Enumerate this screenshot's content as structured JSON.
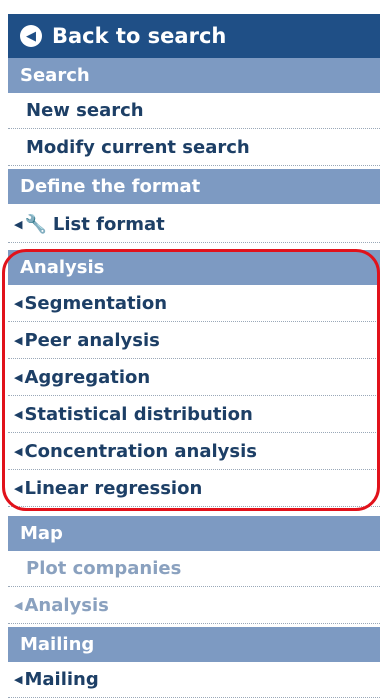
{
  "back_button": {
    "label": "Back to search",
    "icon": "back-arrow-circle-icon"
  },
  "sections": {
    "search": {
      "header": "Search",
      "items": [
        "New search",
        "Modify current search"
      ]
    },
    "format": {
      "header": "Define the format",
      "items": [
        "List format"
      ]
    },
    "analysis": {
      "header": "Analysis",
      "items": [
        "Segmentation",
        "Peer analysis",
        "Aggregation",
        "Statistical distribution",
        "Concentration analysis",
        "Linear regression"
      ]
    },
    "map": {
      "header": "Map",
      "items": [
        "Plot companies",
        "Analysis"
      ]
    },
    "mailing": {
      "header": "Mailing",
      "items": [
        "Mailing"
      ]
    }
  },
  "colors": {
    "nav_blue": "#1f4f86",
    "header_blue": "#7d9ac2",
    "link_text": "#1d3f66",
    "disabled_text": "#8aa1bf",
    "highlight_red": "#e1121b"
  }
}
